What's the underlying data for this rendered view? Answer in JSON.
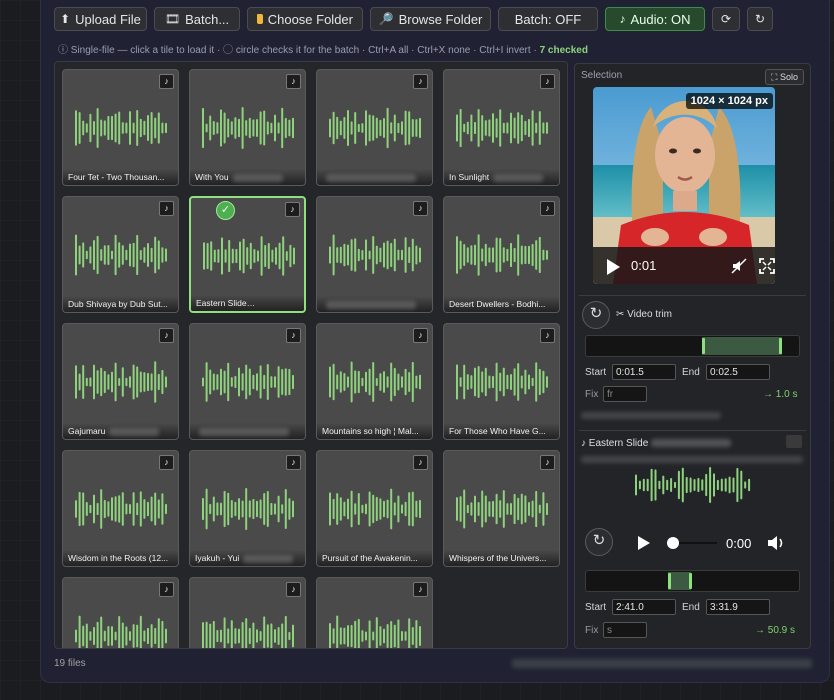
{
  "toolbar": {
    "upload_label": "Upload File",
    "batch_label": "Batch...",
    "choose_folder_label": "Choose Folder",
    "browse_folder_label": "Browse Folder",
    "batch_toggle_label": "Batch: OFF",
    "audio_toggle_label": "Audio: ON",
    "accent_on": "#3f8c49"
  },
  "hint": {
    "text": "ⓘ Single-file — click a tile to load it · ◯ circle checks it for the batch · Ctrl+A all · Ctrl+X none · Ctrl+I invert ·",
    "checked": "7 checked"
  },
  "tiles": [
    {
      "caption": "Four Tet - Two Thousan...",
      "blurred": false
    },
    {
      "caption": "With You",
      "blurred": true
    },
    {
      "caption": "",
      "blurred": true
    },
    {
      "caption": "In Sunlight",
      "blurred": true
    },
    {
      "caption": "Dub Shivaya by Dub Sut...",
      "blurred": false
    },
    {
      "caption": "Eastern Slide",
      "blurred": true,
      "selected": true
    },
    {
      "caption": "",
      "blurred": true
    },
    {
      "caption": "Desert Dwellers - Bodhi...",
      "blurred": false
    },
    {
      "caption": "Gajumaru",
      "blurred": true
    },
    {
      "caption": "",
      "blurred": true
    },
    {
      "caption": "Mountains so high ¦ Mal...",
      "blurred": false
    },
    {
      "caption": "For Those Who Have G...",
      "blurred": false
    },
    {
      "caption": "Wisdom in the Roots (12...",
      "blurred": false
    },
    {
      "caption": "Iyakuh - Yui",
      "blurred": true
    },
    {
      "caption": "Pursuit of the Awakenin...",
      "blurred": false
    },
    {
      "caption": "Whispers of the Univers...",
      "blurred": false
    },
    {
      "caption": "",
      "blurred": false
    },
    {
      "caption": "",
      "blurred": false
    },
    {
      "caption": "",
      "blurred": false
    }
  ],
  "footer": {
    "files_count": "19 files"
  },
  "selection": {
    "title": "Selection",
    "solo_label": "⛶ Solo",
    "image_size": "1024 × 1024 px",
    "video_time": "0:01",
    "video_trim_label": "✂ Video trim",
    "video_trim": {
      "start_fraction": 0.23,
      "end_fraction": 0.39
    },
    "video_start_label": "Start",
    "video_start": "0:01.5",
    "video_end_label": "End",
    "video_end": "0:02.5",
    "video_fix_label": "Fix",
    "video_fix_placeholder": "fr",
    "video_duration": "→ 1.0 s",
    "audio_title": "♪ Eastern Slide",
    "audio_time": "0:00",
    "audio_trim": {
      "start_fraction": 0.39,
      "end_fraction": 0.5
    },
    "audio_start_label": "Start",
    "audio_start": "2:41.0",
    "audio_end_label": "End",
    "audio_end": "3:31.9",
    "audio_fix_label": "Fix",
    "audio_fix_placeholder": "s",
    "audio_duration": "→ 50.9 s"
  }
}
